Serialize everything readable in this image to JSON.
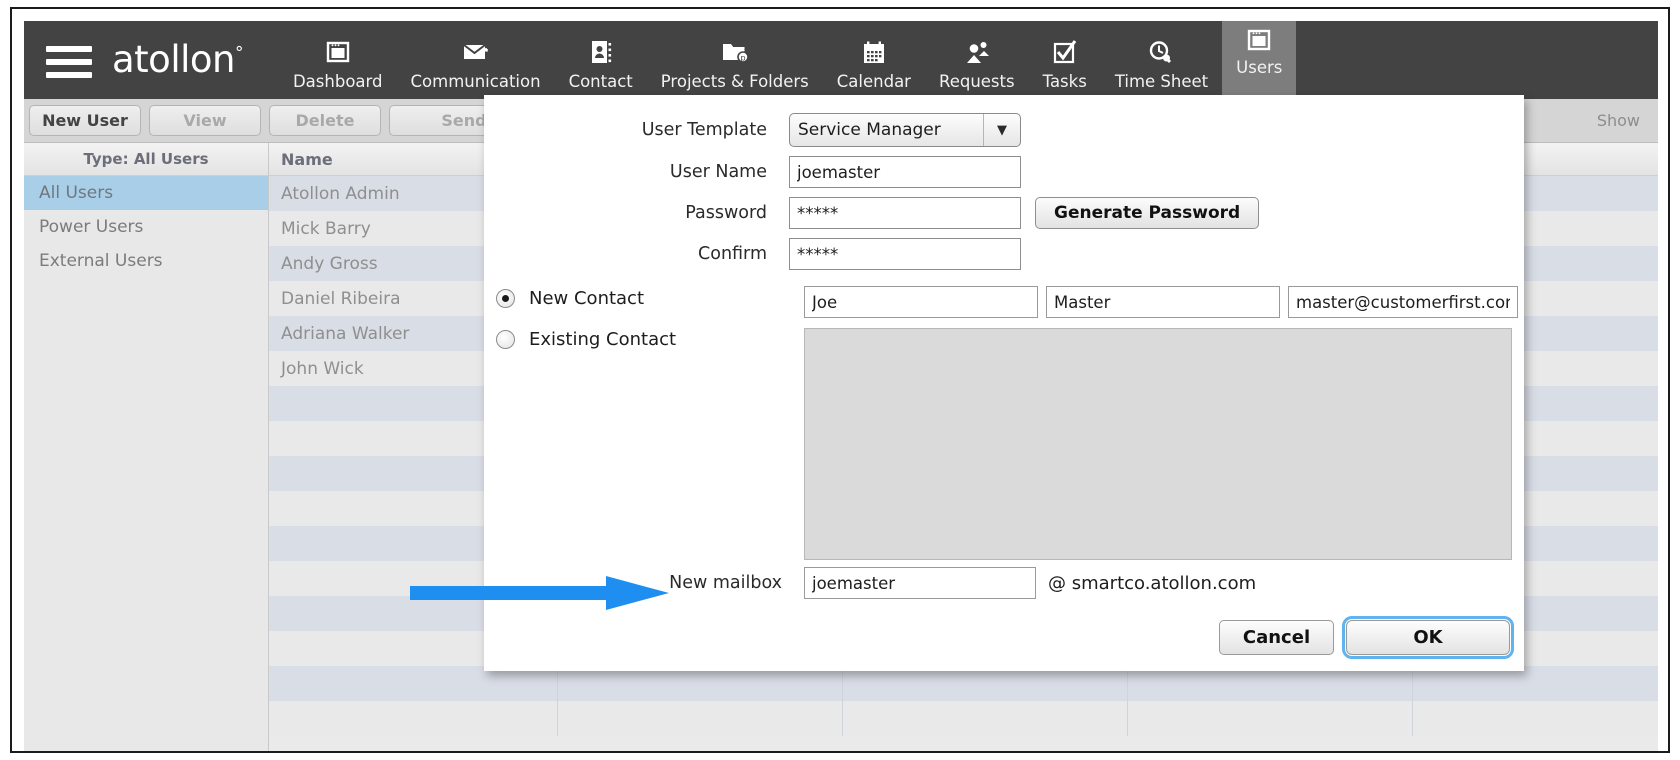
{
  "nav": {
    "brand": "atollon",
    "brand_mark": "°",
    "menu_icon": "hamburger-icon",
    "items": [
      {
        "label": "Dashboard",
        "icon": "dashboard-window-icon",
        "active": false
      },
      {
        "label": "Communication",
        "icon": "envelope-icon",
        "active": false
      },
      {
        "label": "Contact",
        "icon": "address-book-icon",
        "active": false
      },
      {
        "label": "Projects & Folders",
        "icon": "folder-icon",
        "active": false
      },
      {
        "label": "Calendar",
        "icon": "calendar-icon",
        "active": false
      },
      {
        "label": "Requests",
        "icon": "people-icon",
        "active": false
      },
      {
        "label": "Tasks",
        "icon": "checkbox-check-icon",
        "active": false
      },
      {
        "label": "Time Sheet",
        "icon": "clock-search-icon",
        "active": false
      },
      {
        "label": "Users",
        "icon": "window-icon",
        "active": true
      }
    ]
  },
  "toolbar": {
    "buttons": [
      {
        "label": "New User",
        "disabled": false
      },
      {
        "label": "View",
        "disabled": true
      },
      {
        "label": "Delete",
        "disabled": true
      },
      {
        "label": "Send",
        "disabled": true
      }
    ],
    "show_label": "Show"
  },
  "sidepanel": {
    "header": "Type: All Users",
    "items": [
      {
        "label": "All Users",
        "selected": true
      },
      {
        "label": "Power Users",
        "selected": false
      },
      {
        "label": "External Users",
        "selected": false
      }
    ]
  },
  "table": {
    "columns": [
      "Name"
    ],
    "rows": [
      "Atollon Admin",
      "Mick Barry",
      "Andy Gross",
      "Daniel Ribeira",
      "Adriana Walker",
      "John Wick"
    ],
    "empty_row_count": 10
  },
  "dialog": {
    "fields": {
      "user_template_label": "User Template",
      "user_template_value": "Service Manager",
      "user_template_arrow": "▼",
      "user_name_label": "User Name",
      "user_name_value": "joemaster",
      "password_label": "Password",
      "password_value": "*****",
      "confirm_label": "Confirm",
      "confirm_value": "*****",
      "generate_password_label": "Generate Password"
    },
    "contact": {
      "new_contact_label": "New Contact",
      "existing_contact_label": "Existing Contact",
      "selected": "new",
      "first_name": "Joe",
      "last_name": "Master",
      "email": "master@customerfirst.com",
      "first_name_placeholder": "",
      "last_name_placeholder": "",
      "email_placeholder": ""
    },
    "mailbox": {
      "label": "New mailbox",
      "value": "joemaster",
      "suffix": "@  smartco.atollon.com"
    },
    "footer": {
      "cancel_label": "Cancel",
      "ok_label": "OK"
    }
  },
  "annotation": {
    "arrow_color": "#1f8ef1",
    "arrow_name": "pointer-arrow"
  },
  "colors": {
    "nav_background": "#434343",
    "nav_active": "#7d7d7d",
    "selection_blue": "#a8cfe7",
    "row_alt": "#d9dde6",
    "focus_ring": "#5fb4ef"
  }
}
